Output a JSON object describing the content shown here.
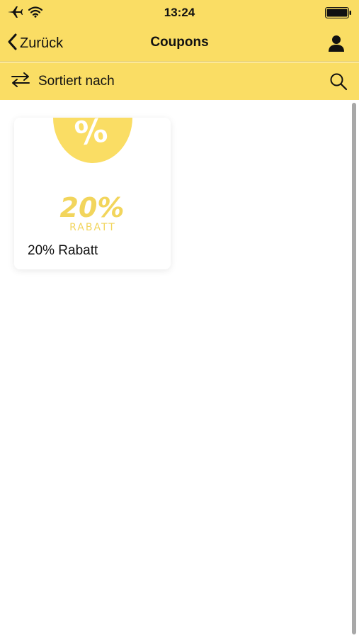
{
  "status": {
    "time": "13:24"
  },
  "nav": {
    "back_label": "Zurück",
    "title": "Coupons"
  },
  "sort": {
    "label": "Sortiert nach"
  },
  "coupons": [
    {
      "title": "20% Rabatt",
      "image_text": "20%",
      "image_subtext": "RABATT"
    }
  ],
  "colors": {
    "accent": "#fadd64",
    "text": "#111111",
    "background": "#ffffff"
  },
  "icons": {
    "status": [
      "airplane-icon",
      "wifi-icon",
      "battery-icon"
    ],
    "nav": [
      "chevron-left-icon",
      "user-icon"
    ],
    "sort": [
      "swap-arrows-icon",
      "search-icon"
    ]
  }
}
